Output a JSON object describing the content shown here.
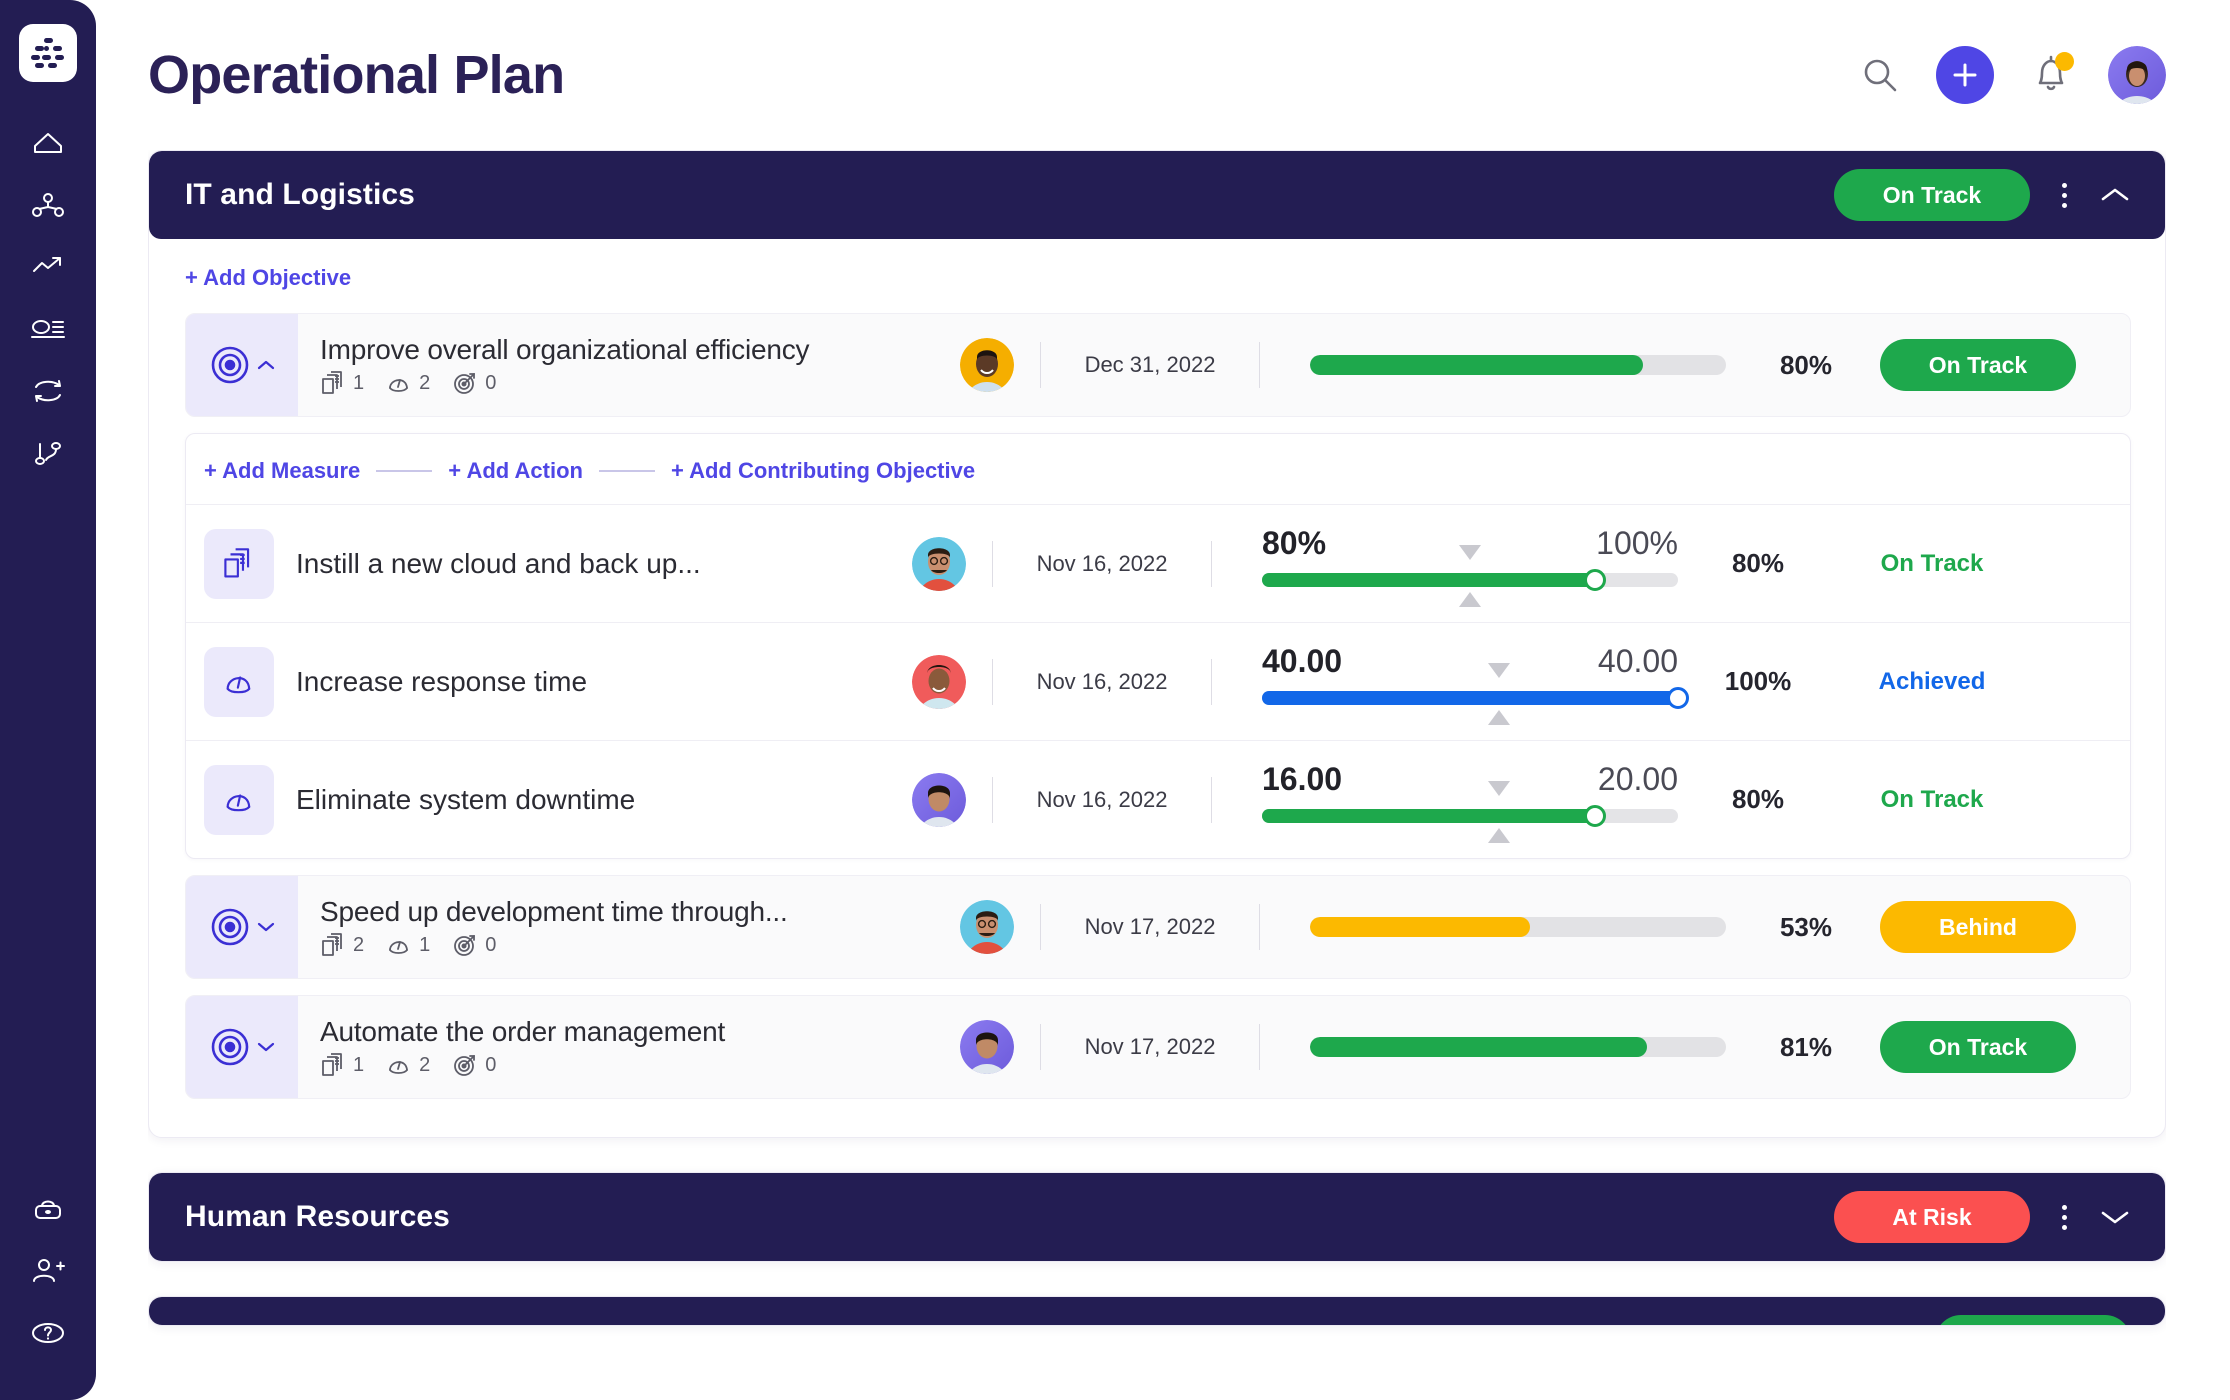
{
  "sidebar": {
    "logo": "logo-dots-icon",
    "items": [
      {
        "name": "home-icon",
        "label": "Home"
      },
      {
        "name": "org-chart-icon",
        "label": "Organization"
      },
      {
        "name": "trending-up-icon",
        "label": "Performance"
      },
      {
        "name": "list-detail-icon",
        "label": "Reports"
      },
      {
        "name": "refresh-cycle-icon",
        "label": "Cycles"
      },
      {
        "name": "branch-icon",
        "label": "Alignment"
      }
    ],
    "bottom_items": [
      {
        "name": "lock-icon",
        "label": "Security"
      },
      {
        "name": "add-user-icon",
        "label": "Invite"
      },
      {
        "name": "help-icon",
        "label": "Help"
      }
    ]
  },
  "header": {
    "title": "Operational Plan",
    "search_icon": "search-icon",
    "add_icon": "plus-icon",
    "notifications_icon": "bell-icon",
    "has_notification": true,
    "avatar": "user-avatar"
  },
  "colors": {
    "brand": "#4f46e5",
    "navy": "#231d53",
    "green": "#1ea84c",
    "amber": "#fcb900",
    "red": "#fb5050",
    "blue": "#1267e8"
  },
  "sections": [
    {
      "title": "IT and Logistics",
      "status": "On Track",
      "status_color": "green",
      "expanded": true,
      "add_objective_label": "+ Add Objective",
      "objectives": [
        {
          "title": "Improve overall organizational efficiency",
          "expanded": true,
          "counts": {
            "notes": "1",
            "measures": "2",
            "objectives": "0"
          },
          "date": "Dec 31, 2022",
          "progress": 80,
          "progress_label": "80%",
          "progress_color": "green",
          "status": "On Track",
          "status_color": "green",
          "add_links": {
            "measure": "+ Add Measure",
            "action": "+ Add Action",
            "contributing": "+ Add Contributing Objective"
          },
          "measures": [
            {
              "icon": "document-stack-icon",
              "title": "Instill a new cloud and back up...",
              "date": "Nov 16, 2022",
              "current": "80%",
              "target": "100%",
              "fill": 80,
              "marker": 50,
              "color": "green",
              "percent": "80%",
              "status": "On Track",
              "status_color": "green"
            },
            {
              "icon": "gauge-icon",
              "title": "Increase response time",
              "date": "Nov 16, 2022",
              "current": "40.00",
              "target": "40.00",
              "fill": 100,
              "marker": 57,
              "color": "blue",
              "percent": "100%",
              "status": "Achieved",
              "status_color": "blue"
            },
            {
              "icon": "gauge-icon",
              "title": "Eliminate system downtime",
              "date": "Nov 16, 2022",
              "current": "16.00",
              "target": "20.00",
              "fill": 80,
              "marker": 57,
              "color": "green",
              "percent": "80%",
              "status": "On Track",
              "status_color": "green"
            }
          ]
        },
        {
          "title": "Speed up development time through...",
          "expanded": false,
          "counts": {
            "notes": "2",
            "measures": "1",
            "objectives": "0"
          },
          "date": "Nov 17, 2022",
          "progress": 53,
          "progress_label": "53%",
          "progress_color": "amber",
          "status": "Behind",
          "status_color": "amber",
          "measures": []
        },
        {
          "title": "Automate the order management",
          "expanded": false,
          "counts": {
            "notes": "1",
            "measures": "2",
            "objectives": "0"
          },
          "date": "Nov 17, 2022",
          "progress": 81,
          "progress_label": "81%",
          "progress_color": "green",
          "status": "On Track",
          "status_color": "green",
          "measures": []
        }
      ]
    },
    {
      "title": "Human Resources",
      "status": "At Risk",
      "status_color": "red",
      "expanded": false,
      "objectives": []
    }
  ]
}
